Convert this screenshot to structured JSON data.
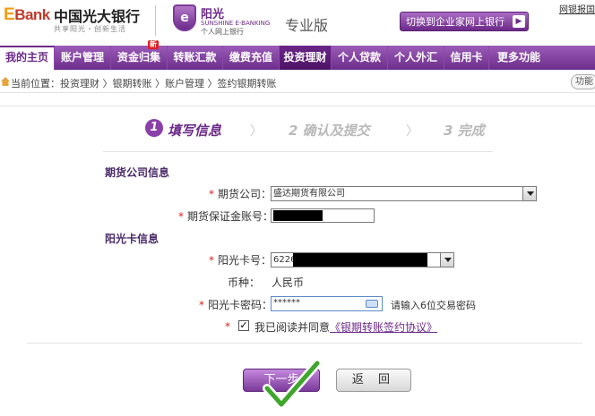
{
  "header": {
    "logo_letter": "E",
    "logo_rest": "Bank",
    "bank_name": "中国光大银行",
    "slogan": "共享阳光・创新生活",
    "sun_badge": "e",
    "sun_title": "阳光",
    "sun_sub": "SUNSHINE E-BANKING",
    "sun_sub2": "个人网上银行",
    "edition": "专业版",
    "corp_button": "切换到企业家网上银行",
    "help_link": "网银报国"
  },
  "nav": {
    "items": [
      {
        "label": "我的主页"
      },
      {
        "label": "账户管理"
      },
      {
        "label": "资金归集"
      },
      {
        "label": "转账汇款"
      },
      {
        "label": "缴费充值"
      },
      {
        "label": "投资理财"
      },
      {
        "label": "个人贷款"
      },
      {
        "label": "个人外汇"
      },
      {
        "label": "信用卡"
      },
      {
        "label": "更多功能"
      }
    ],
    "new_badge": "新",
    "active_index": 5
  },
  "breadcrumb": {
    "text": "当前位置：投资理财 〉银期转账 〉账户管理 〉签约银期转账",
    "func_button": "功能"
  },
  "steps": [
    {
      "num": "1",
      "label": "填写信息"
    },
    {
      "num": "2",
      "label": "确认及提交"
    },
    {
      "num": "3",
      "label": "完成"
    }
  ],
  "form": {
    "futures_section": "期货公司信息",
    "futures_company_label": "期货公司：",
    "futures_company_value": "盛达期货有限公司",
    "margin_account_label": "期货保证金账号：",
    "card_section": "阳光卡信息",
    "card_number_label": "阳光卡号：",
    "card_number_prefix": "6226",
    "currency_label": "币种：",
    "currency_value": "人民币",
    "password_label": "阳光卡密码：",
    "password_value": "******",
    "password_hint": "请输入6位交易密码",
    "agree_text": "我已阅读并同意",
    "agree_link": "《银期转账签约协议》",
    "required_mark": "*",
    "checkbox_checked": true,
    "checkbox_glyph": "✓"
  },
  "buttons": {
    "next": "下一步",
    "back": "返 回"
  },
  "colors": {
    "brand_purple": "#6c2a89",
    "required_red": "#e02020"
  }
}
